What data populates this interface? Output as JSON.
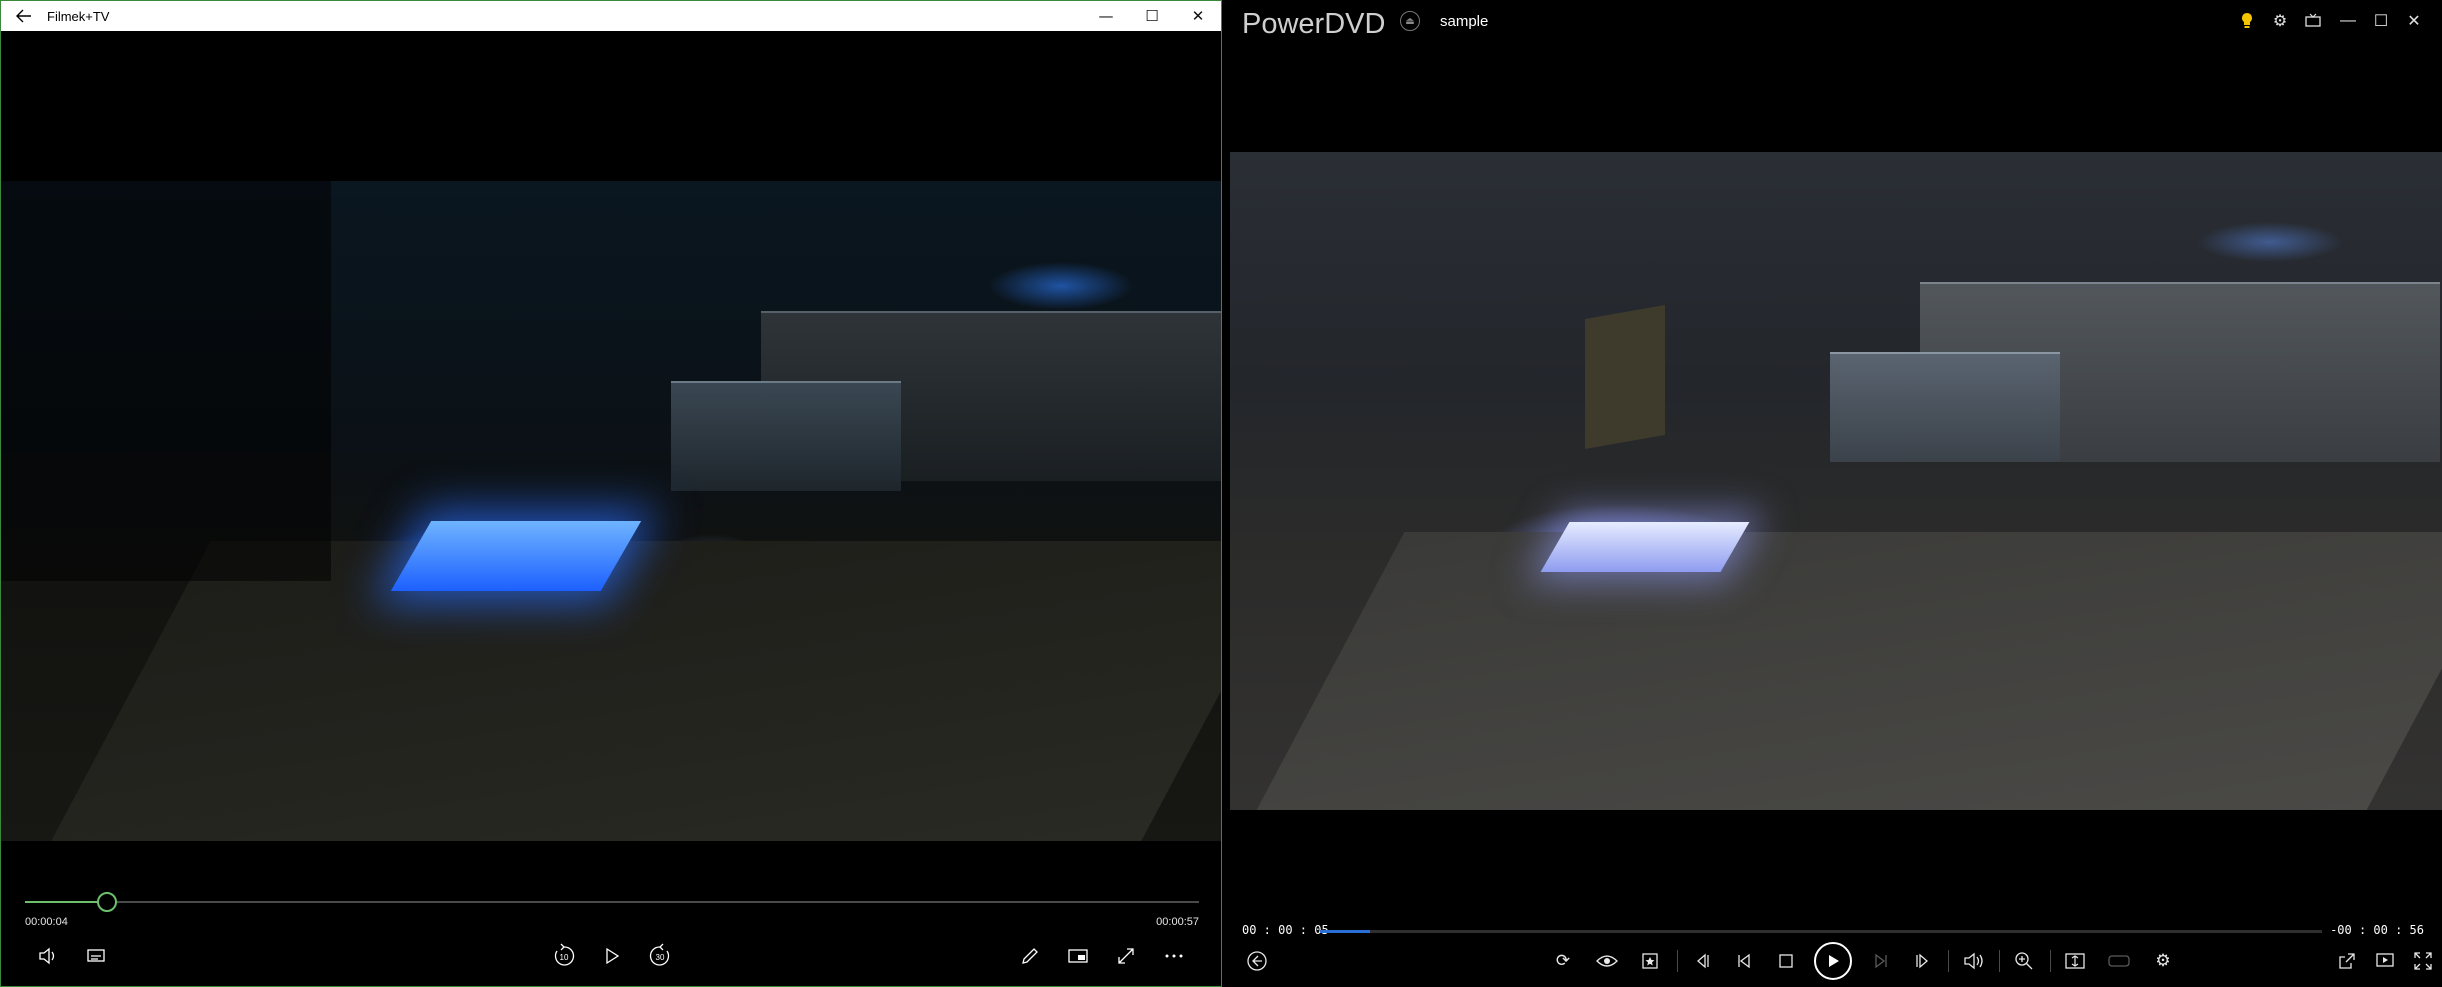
{
  "left_window": {
    "title": "Filmek+TV",
    "caption_buttons": {
      "minimize": "—",
      "maximize": "☐",
      "close": "✕"
    },
    "back_icon": "back-arrow-icon",
    "accent_color": "#6cc06c",
    "playback": {
      "elapsed": "00:00:04",
      "duration": "00:00:57",
      "progress_fraction": 0.07
    },
    "controls": {
      "volume_icon": "volume-icon",
      "subtitles_icon": "subtitles-icon",
      "skip_back_label": "10",
      "play_icon": "play-icon",
      "skip_forward_label": "30",
      "edit_icon": "pencil-icon",
      "miniview_icon": "mini-view-icon",
      "fullscreen_icon": "fullscreen-icon",
      "more_icon": "more-icon"
    }
  },
  "right_window": {
    "app_name": "PowerDVD",
    "file_name": "sample",
    "accent_color": "#2a6fd6",
    "top_icons": [
      "lightbulb-icon",
      "settings-icon",
      "tv-mode-icon",
      "minimize-icon",
      "maximize-icon",
      "close-icon"
    ],
    "playback": {
      "elapsed": "00 : 00 : 05",
      "remaining": "-00 : 00 : 56",
      "progress_fraction": 0.05
    },
    "controls": [
      "back-icon",
      "repeat-icon",
      "eye-icon",
      "bookmark-icon",
      "prev-frame-icon",
      "prev-chapter-icon",
      "stop-icon",
      "play-icon",
      "next-chapter-icon",
      "next-frame-icon",
      "volume-icon",
      "zoom-icon",
      "aspect-icon",
      "vr-icon",
      "settings-icon",
      "popout-icon",
      "mini-player-icon",
      "fullscreen-icon"
    ]
  }
}
